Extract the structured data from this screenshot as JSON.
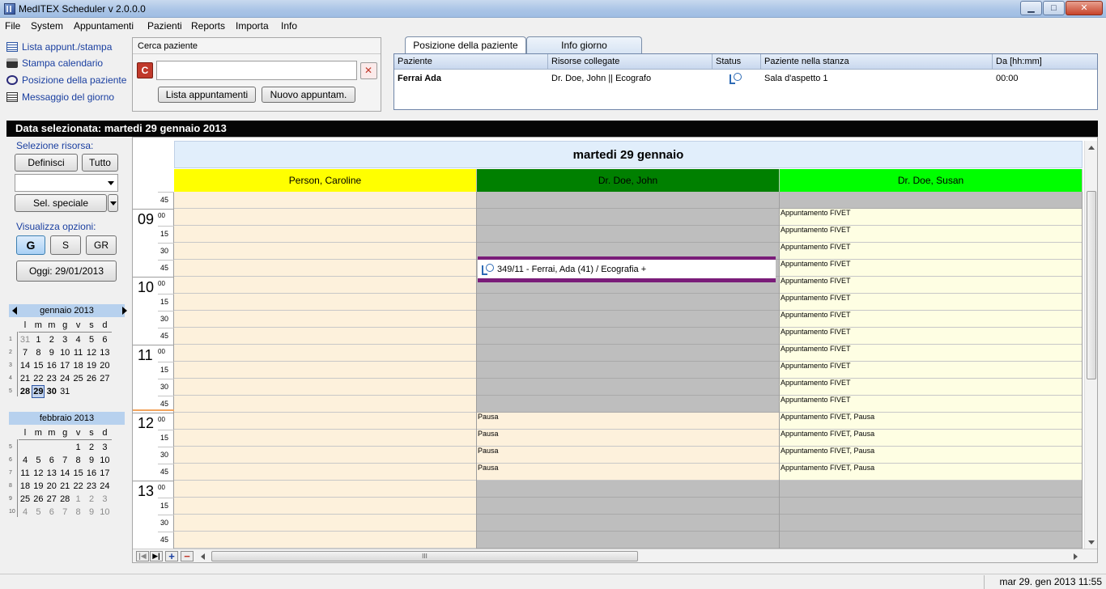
{
  "window": {
    "title": "MedITEX  Scheduler v 2.0.0.0",
    "minimize_glyph": "▁",
    "maximize_glyph": "□",
    "close_glyph": "✕"
  },
  "menu": [
    {
      "label": "File"
    },
    {
      "label": "System"
    },
    {
      "label": "Appuntamenti"
    },
    {
      "label": "Pazienti"
    },
    {
      "label": "Reports"
    },
    {
      "label": "Importa"
    },
    {
      "label": "Info"
    }
  ],
  "quick_links": [
    {
      "label": "Lista appunt./stampa",
      "icon": "list-icon"
    },
    {
      "label": "Stampa calendario",
      "icon": "printer-icon"
    },
    {
      "label": "Posizione della paziente",
      "icon": "patient-position-icon"
    },
    {
      "label": "Messaggio del giorno",
      "icon": "message-icon"
    }
  ],
  "search": {
    "title": "Cerca paziente",
    "value": "",
    "list_button": "Lista appuntamenti",
    "new_button": "Nuovo appuntam.",
    "mode_glyph": "C"
  },
  "position_panel": {
    "tabs": [
      "Posizione della paziente",
      "Info giorno"
    ],
    "columns": [
      "Paziente",
      "Risorse collegate",
      "Status",
      "Paziente nella stanza",
      "Da [hh:mm]"
    ],
    "rows": [
      {
        "patient": "Ferrai Ada",
        "resources": "Dr. Doe, John || Ecografo",
        "status_icon": "waiting-patient-icon",
        "room": "Sala d'aspetto 1",
        "since": "00:00"
      }
    ]
  },
  "date_bar": "Data selezionata: martedi 29 gennaio 2013",
  "sidebar": {
    "resource_label": "Selezione risorsa:",
    "define_button": "Definisci",
    "all_button": "Tutto",
    "resource_select": "",
    "special_button": "Sel. speciale",
    "view_label": "Visualizza opzioni:",
    "view_buttons": [
      "G",
      "S",
      "GR"
    ],
    "today_button": "Oggi: 29/01/2013"
  },
  "calendars": [
    {
      "title": "gennaio 2013",
      "dow": [
        "l",
        "m",
        "m",
        "g",
        "v",
        "s",
        "d"
      ],
      "weeks": [
        {
          "wk": "1",
          "days": [
            {
              "d": "31",
              "other": true
            },
            {
              "d": "1"
            },
            {
              "d": "2"
            },
            {
              "d": "3"
            },
            {
              "d": "4"
            },
            {
              "d": "5"
            },
            {
              "d": "6"
            }
          ]
        },
        {
          "wk": "2",
          "days": [
            {
              "d": "7"
            },
            {
              "d": "8"
            },
            {
              "d": "9"
            },
            {
              "d": "10"
            },
            {
              "d": "11"
            },
            {
              "d": "12"
            },
            {
              "d": "13"
            }
          ]
        },
        {
          "wk": "3",
          "days": [
            {
              "d": "14"
            },
            {
              "d": "15"
            },
            {
              "d": "16"
            },
            {
              "d": "17"
            },
            {
              "d": "18"
            },
            {
              "d": "19"
            },
            {
              "d": "20"
            }
          ]
        },
        {
          "wk": "4",
          "days": [
            {
              "d": "21"
            },
            {
              "d": "22"
            },
            {
              "d": "23"
            },
            {
              "d": "24"
            },
            {
              "d": "25"
            },
            {
              "d": "26"
            },
            {
              "d": "27"
            }
          ]
        },
        {
          "wk": "5",
          "days": [
            {
              "d": "28",
              "bold": true
            },
            {
              "d": "29",
              "selected": true
            },
            {
              "d": "30",
              "bold": true
            },
            {
              "d": "31"
            },
            {
              "d": ""
            },
            {
              "d": ""
            },
            {
              "d": ""
            }
          ]
        }
      ]
    },
    {
      "title": "febbraio 2013",
      "dow": [
        "l",
        "m",
        "m",
        "g",
        "v",
        "s",
        "d"
      ],
      "weeks": [
        {
          "wk": "5",
          "days": [
            {
              "d": ""
            },
            {
              "d": ""
            },
            {
              "d": ""
            },
            {
              "d": ""
            },
            {
              "d": "1"
            },
            {
              "d": "2"
            },
            {
              "d": "3"
            }
          ]
        },
        {
          "wk": "6",
          "days": [
            {
              "d": "4"
            },
            {
              "d": "5"
            },
            {
              "d": "6"
            },
            {
              "d": "7"
            },
            {
              "d": "8"
            },
            {
              "d": "9"
            },
            {
              "d": "10"
            }
          ]
        },
        {
          "wk": "7",
          "days": [
            {
              "d": "11"
            },
            {
              "d": "12"
            },
            {
              "d": "13"
            },
            {
              "d": "14"
            },
            {
              "d": "15"
            },
            {
              "d": "16"
            },
            {
              "d": "17"
            }
          ]
        },
        {
          "wk": "8",
          "days": [
            {
              "d": "18"
            },
            {
              "d": "19"
            },
            {
              "d": "20"
            },
            {
              "d": "21"
            },
            {
              "d": "22"
            },
            {
              "d": "23"
            },
            {
              "d": "24"
            }
          ]
        },
        {
          "wk": "9",
          "days": [
            {
              "d": "25"
            },
            {
              "d": "26"
            },
            {
              "d": "27"
            },
            {
              "d": "28"
            },
            {
              "d": "1",
              "other": true
            },
            {
              "d": "2",
              "other": true
            },
            {
              "d": "3",
              "other": true
            }
          ]
        },
        {
          "wk": "10",
          "days": [
            {
              "d": "4",
              "other": true
            },
            {
              "d": "5",
              "other": true
            },
            {
              "d": "6",
              "other": true
            },
            {
              "d": "7",
              "other": true
            },
            {
              "d": "8",
              "other": true
            },
            {
              "d": "9",
              "other": true
            },
            {
              "d": "10",
              "other": true
            }
          ]
        }
      ]
    }
  ],
  "schedule": {
    "day_title": "martedi 29 gennaio",
    "resources": [
      {
        "name": "Person, Caroline",
        "color": "#ffff00",
        "text_color": "#000000"
      },
      {
        "name": "Dr. Doe, John",
        "color": "#008000",
        "text_color": "#000000"
      },
      {
        "name": "Dr. Doe, Susan",
        "color": "#00ff00",
        "text_color": "#000000"
      }
    ],
    "time_rows": [
      {
        "hour": "",
        "min": "45"
      },
      {
        "hour": "09",
        "min": "00"
      },
      {
        "hour": "",
        "min": "15"
      },
      {
        "hour": "",
        "min": "30"
      },
      {
        "hour": "",
        "min": "45"
      },
      {
        "hour": "10",
        "min": "00"
      },
      {
        "hour": "",
        "min": "15"
      },
      {
        "hour": "",
        "min": "30"
      },
      {
        "hour": "",
        "min": "45"
      },
      {
        "hour": "11",
        "min": "00"
      },
      {
        "hour": "",
        "min": "15"
      },
      {
        "hour": "",
        "min": "30"
      },
      {
        "hour": "",
        "min": "45"
      },
      {
        "hour": "12",
        "min": "00"
      },
      {
        "hour": "",
        "min": "15"
      },
      {
        "hour": "",
        "min": "30"
      },
      {
        "hour": "",
        "min": "45"
      },
      {
        "hour": "13",
        "min": "00"
      },
      {
        "hour": "",
        "min": "15"
      },
      {
        "hour": "",
        "min": "30"
      },
      {
        "hour": "",
        "min": "45"
      }
    ],
    "current_time_row": 12,
    "columns": [
      {
        "slots": [
          "a",
          "a",
          "a",
          "a",
          "a",
          "a",
          "a",
          "a",
          "a",
          "a",
          "a",
          "a",
          "a",
          "a",
          "a",
          "a",
          "a",
          "a",
          "a",
          "a",
          "a"
        ],
        "labels": []
      },
      {
        "slots": [
          "busy",
          "busy",
          "busy",
          "busy",
          "busy",
          "busy",
          "busy",
          "busy",
          "busy",
          "busy",
          "busy",
          "busy",
          "busy",
          "a",
          "a",
          "a",
          "a",
          "busy",
          "busy",
          "busy",
          "busy"
        ],
        "labels": [
          "",
          "",
          "",
          "",
          "",
          "",
          "",
          "",
          "",
          "",
          "",
          "",
          "",
          "Pausa",
          "Pausa",
          "Pausa",
          "Pausa",
          "",
          "",
          "",
          ""
        ]
      },
      {
        "slots": [
          "busy",
          "b",
          "b",
          "b",
          "b",
          "b",
          "b",
          "b",
          "b",
          "b",
          "b",
          "b",
          "b",
          "b",
          "b",
          "b",
          "b",
          "busy",
          "busy",
          "busy",
          "busy"
        ],
        "labels": [
          "",
          "Appuntamento FIVET",
          "Appuntamento FIVET",
          "Appuntamento FIVET",
          "Appuntamento FIVET",
          "Appuntamento FIVET",
          "Appuntamento FIVET",
          "Appuntamento FIVET",
          "Appuntamento FIVET",
          "Appuntamento FIVET",
          "Appuntamento FIVET",
          "Appuntamento FIVET",
          "Appuntamento FIVET",
          "Appuntamento FIVET, Pausa",
          "Appuntamento FIVET, Pausa",
          "Appuntamento FIVET, Pausa",
          "Appuntamento FIVET, Pausa",
          "",
          "",
          "",
          ""
        ]
      }
    ],
    "appointment": "349/11 - Ferrai, Ada (41) / Ecografia +",
    "hscroll_grip": "III"
  },
  "status_bar": "mar 29. gen 2013 11:55"
}
